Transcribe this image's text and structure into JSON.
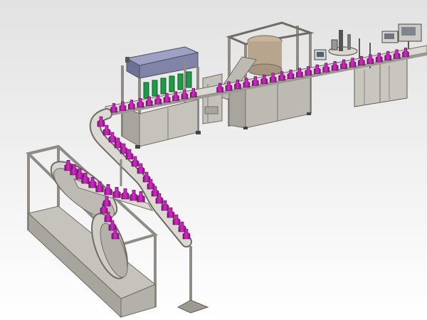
{
  "scene": {
    "kind": "3D CAD render of an automatic bottle filling, capping and labeling production line",
    "colors": {
      "background_top": "#e4e4e4",
      "background_bottom": "#ffffff",
      "frame": "#bdbab3",
      "frame_dark": "#6f6c66",
      "bottle": "#c21fb6",
      "bottle_dark": "#7e0f77",
      "filler_hood": "#8184a6",
      "nozzle": "#1f9a46",
      "cap_hopper": "#b8a58e",
      "conveyor": "#d9d6cf"
    },
    "machines": [
      {
        "id": "unscrambler",
        "icon": "rotary-unscrambler"
      },
      {
        "id": "conveyor",
        "icon": "curved-conveyor"
      },
      {
        "id": "filler",
        "icon": "piston-filler",
        "nozzle_count": 6
      },
      {
        "id": "capper",
        "icon": "capping-machine"
      },
      {
        "id": "labeler",
        "icon": "labeling-machine"
      }
    ]
  }
}
